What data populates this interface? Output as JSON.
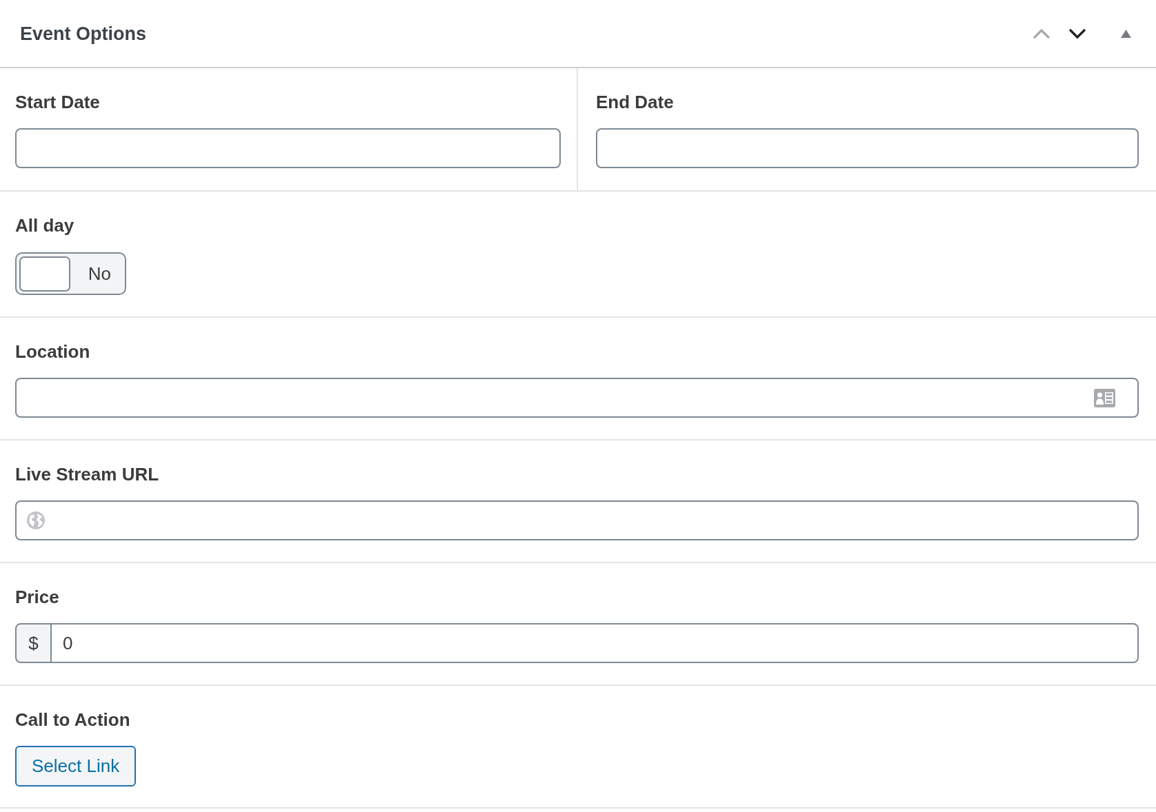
{
  "panel": {
    "title": "Event Options",
    "controls": [
      {
        "kind": "move_up",
        "disabled": true
      },
      {
        "kind": "move_down",
        "disabled": false
      },
      {
        "kind": "collapse",
        "expanded": true
      }
    ]
  },
  "fields": [
    {
      "kind": "date_pair",
      "columns": [
        {
          "label": "Start Date"
        },
        {
          "label": "End Date"
        }
      ]
    },
    {
      "kind": "toggle",
      "label": "All day",
      "on": false,
      "text": "No"
    },
    {
      "kind": "location",
      "label": "Location"
    },
    {
      "kind": "url",
      "label": "Live Stream URL"
    },
    {
      "kind": "price",
      "label": "Price",
      "prefix": "$",
      "value": "0"
    },
    {
      "kind": "link",
      "label": "Call to Action",
      "button": "Select Link"
    }
  ]
}
